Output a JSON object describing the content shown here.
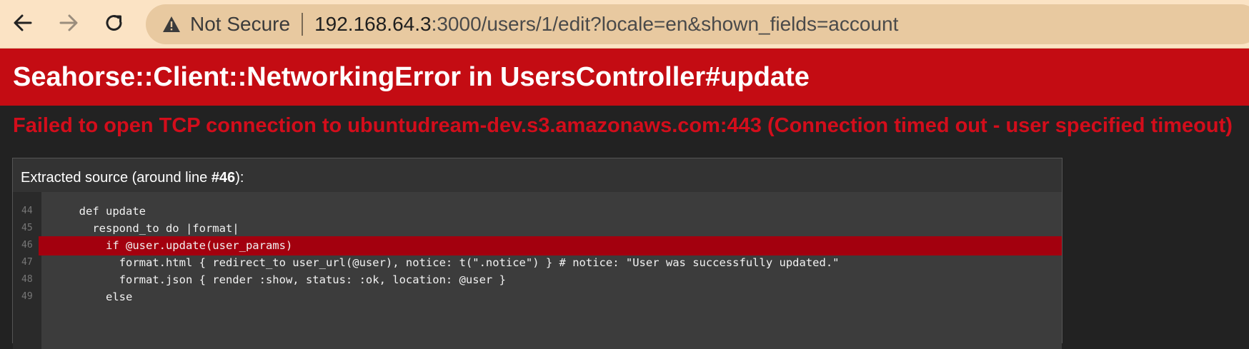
{
  "browser": {
    "security_label": "Not Secure",
    "url_host": "192.168.64.3",
    "url_path": ":3000/users/1/edit?locale=en&shown_fields=account"
  },
  "error": {
    "title": "Seahorse::Client::NetworkingError in UsersController#update",
    "message": "Failed to open TCP connection to ubuntudream-dev.s3.amazonaws.com:443 (Connection timed out - user specified timeout)"
  },
  "source": {
    "heading_prefix": "Extracted source (around line ",
    "heading_line": "#46",
    "heading_suffix": "):",
    "lines": [
      {
        "no": "44",
        "code": "  def update"
      },
      {
        "no": "45",
        "code": "    respond_to do |format|"
      },
      {
        "no": "46",
        "code": "      if @user.update(user_params)"
      },
      {
        "no": "47",
        "code": "        format.html { redirect_to user_url(@user), notice: t(\".notice\") } # notice: \"User was successfully updated.\""
      },
      {
        "no": "48",
        "code": "        format.json { render :show, status: :ok, location: @user }"
      },
      {
        "no": "49",
        "code": "      else"
      }
    ]
  },
  "colors": {
    "browser_bar": "#fbe3c4",
    "error_header": "#c40c13",
    "error_message": "#d30d1b",
    "highlight_line": "#a3000e",
    "page_background": "#222222"
  },
  "icons": {
    "back": "arrow-left-icon",
    "forward": "arrow-right-icon",
    "reload": "reload-icon",
    "security": "warning-triangle-icon"
  }
}
